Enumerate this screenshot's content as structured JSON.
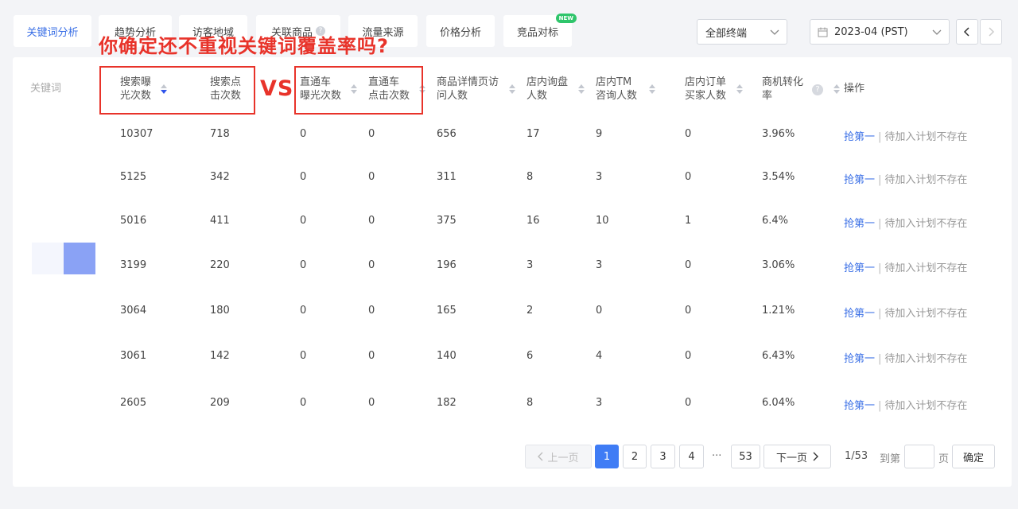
{
  "tabs": [
    {
      "label": "关键词分析",
      "active": true
    },
    {
      "label": "趋势分析"
    },
    {
      "label": "访客地域"
    },
    {
      "label": "关联商品",
      "has_help": true
    },
    {
      "label": "流量来源"
    },
    {
      "label": "价格分析"
    },
    {
      "label": "竞品对标",
      "badge": "NEW"
    }
  ],
  "filters": {
    "terminal": "全部终端",
    "date": "2023-04 (PST)"
  },
  "banner": "你确定还不重视关键词覆盖率吗?",
  "vs_label": "VS",
  "columns": {
    "keyword": "关键词",
    "search_impr_1": "搜索曝",
    "search_impr_2": "光次数",
    "search_click_1": "搜索点",
    "search_click_2": "击次数",
    "p4p_impr_1": "直通车",
    "p4p_impr_2": "曝光次数",
    "p4p_click_1": "直通车",
    "p4p_click_2": "点击次数",
    "detail_visitors_1": "商品详情页访",
    "detail_visitors_2": "问人数",
    "inquiry_1": "店内询盘",
    "inquiry_2": "人数",
    "tm_1": "店内TM",
    "tm_2": "咨询人数",
    "order_1": "店内订单",
    "order_2": "买家人数",
    "conv_1": "商机转化",
    "conv_2": "率",
    "action": "操作"
  },
  "rows": [
    {
      "search_impr": "10307",
      "search_click": "718",
      "p4p_impr": "0",
      "p4p_click": "0",
      "detail_visitors": "656",
      "inquiry": "17",
      "tm": "9",
      "order": "0",
      "conv": "3.96%"
    },
    {
      "search_impr": "5125",
      "search_click": "342",
      "p4p_impr": "0",
      "p4p_click": "0",
      "detail_visitors": "311",
      "inquiry": "8",
      "tm": "3",
      "order": "0",
      "conv": "3.54%"
    },
    {
      "search_impr": "5016",
      "search_click": "411",
      "p4p_impr": "0",
      "p4p_click": "0",
      "detail_visitors": "375",
      "inquiry": "16",
      "tm": "10",
      "order": "1",
      "conv": "6.4%"
    },
    {
      "search_impr": "3199",
      "search_click": "220",
      "p4p_impr": "0",
      "p4p_click": "0",
      "detail_visitors": "196",
      "inquiry": "3",
      "tm": "3",
      "order": "0",
      "conv": "3.06%"
    },
    {
      "search_impr": "3064",
      "search_click": "180",
      "p4p_impr": "0",
      "p4p_click": "0",
      "detail_visitors": "165",
      "inquiry": "2",
      "tm": "0",
      "order": "0",
      "conv": "1.21%"
    },
    {
      "search_impr": "3061",
      "search_click": "142",
      "p4p_impr": "0",
      "p4p_click": "0",
      "detail_visitors": "140",
      "inquiry": "6",
      "tm": "4",
      "order": "0",
      "conv": "6.43%"
    },
    {
      "search_impr": "2605",
      "search_click": "209",
      "p4p_impr": "0",
      "p4p_click": "0",
      "detail_visitors": "182",
      "inquiry": "8",
      "tm": "3",
      "order": "0",
      "conv": "6.04%"
    }
  ],
  "row_action": {
    "link": "抢第一",
    "sep": "|",
    "status": "待加入计划不存在"
  },
  "pagination": {
    "prev": "上一页",
    "pages": [
      "1",
      "2",
      "3",
      "4"
    ],
    "ellipsis": "···",
    "last": "53",
    "next": "下一页",
    "summary": "1/53",
    "goto_label": "到第",
    "page_unit": "页",
    "goto_value": "",
    "confirm": "确定",
    "current": 1
  },
  "colors": {
    "accent": "#3f7cf5",
    "annotation": "#e8332a"
  }
}
